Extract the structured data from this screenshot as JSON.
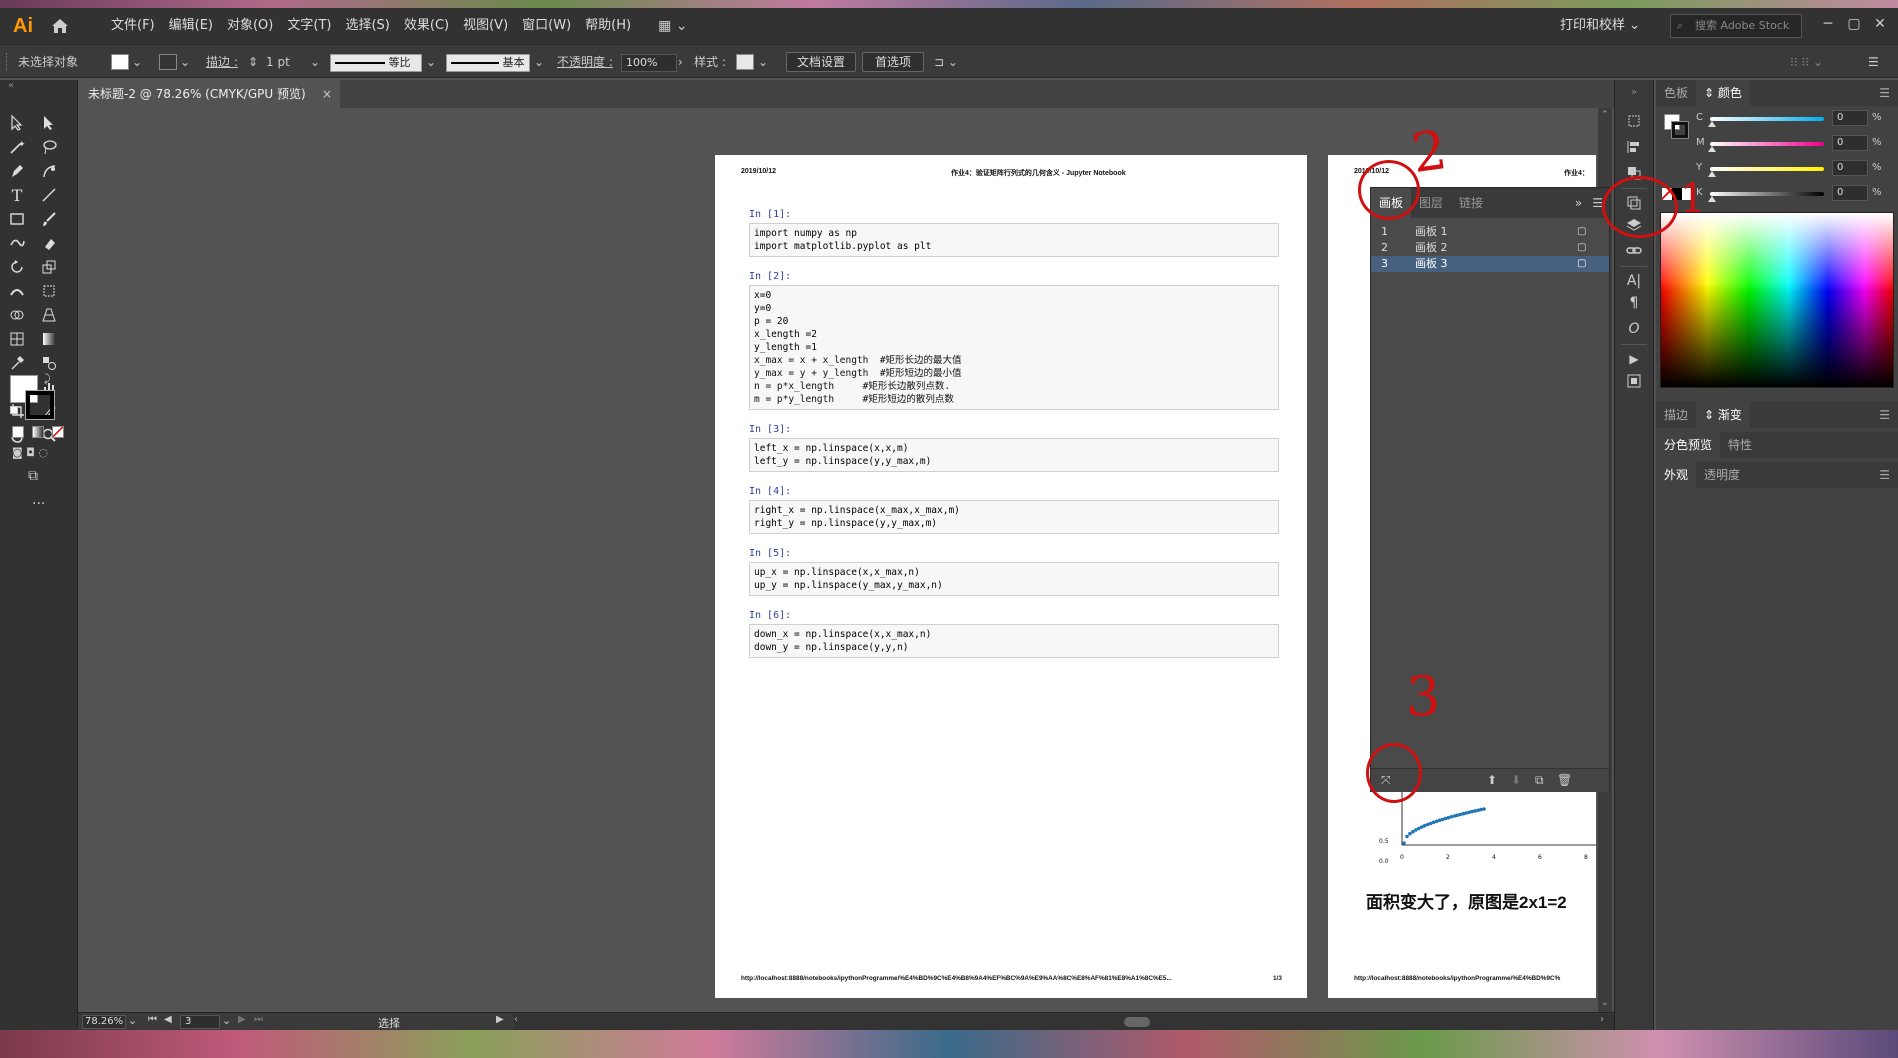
{
  "app": {
    "logo": "Ai",
    "workspace": "打印和校样",
    "search_placeholder": "搜索 Adobe Stock"
  },
  "menu": [
    "文件(F)",
    "编辑(E)",
    "对象(O)",
    "文字(T)",
    "选择(S)",
    "效果(C)",
    "视图(V)",
    "窗口(W)",
    "帮助(H)"
  ],
  "controlbar": {
    "selection": "未选择对象",
    "stroke_label": "描边 :",
    "stroke_value": "1 pt",
    "profile1": "等比",
    "profile2": "基本",
    "opacity_label": "不透明度 :",
    "opacity_value": "100%",
    "style_label": "样式 :",
    "doc_setup": "文档设置",
    "preferences": "首选项"
  },
  "document_tab": {
    "title": "未标题-2 @ 78.26% (CMYK/GPU 预览)",
    "close": "×"
  },
  "page1": {
    "date": "2019/10/12",
    "header_title": "作业4：验证矩阵行列式的几何含义 - Jupyter Notebook",
    "footer_url": "http://localhost:8888/notebooks/ipythonProgramme/%E4%BD%9C%E4%B8%9A4%EF%BC%9A%E9%AA%8C%E8%AF%81%E8%A1%8C%E5...",
    "footer_page": "1/3",
    "cells": [
      {
        "label": "In  [1]:",
        "lines": [
          "import numpy as np",
          "import matplotlib.pyplot as plt"
        ]
      },
      {
        "label": "In  [2]:",
        "lines": [
          "x=0",
          "y=0",
          "p = 20",
          "x_length =2",
          "y_length =1",
          "x_max = x + x_length  #矩形长边的最大值",
          "y_max = y + y_length  #矩形短边的最小值",
          "n = p*x_length     #矩形长边散列点数.",
          "m = p*y_length     #矩形短边的散列点数"
        ]
      },
      {
        "label": "In  [3]:",
        "lines": [
          "left_x = np.linspace(x,x,m)",
          "left_y = np.linspace(y,y_max,m)"
        ]
      },
      {
        "label": "In  [4]:",
        "lines": [
          "right_x = np.linspace(x_max,x_max,m)",
          "right_y = np.linspace(y,y_max,m)"
        ]
      },
      {
        "label": "In  [5]:",
        "lines": [
          "up_x = np.linspace(x,x_max,n)",
          "up_y = np.linspace(y_max,y_max,n)"
        ]
      },
      {
        "label": "In  [6]:",
        "lines": [
          "down_x = np.linspace(x,x_max,n)",
          "down_y = np.linspace(y,y,n)"
        ]
      }
    ]
  },
  "page2": {
    "date": "2019/10/12",
    "header_title": "作业4：",
    "big_text": "面积变大了，原图是2x1=2",
    "footer_url": "http://localhost:8888/notebooks/ipythonProgramme/%E4%BD%9C%",
    "axis_ticks_x": [
      "0",
      "2",
      "4",
      "6",
      "8"
    ],
    "axis_ticks_y": [
      "0.5",
      "0.0"
    ]
  },
  "artboard_panel": {
    "tabs": [
      "画板",
      "图层",
      "链接"
    ],
    "rows": [
      {
        "index": "1",
        "name": "画板 1"
      },
      {
        "index": "2",
        "name": "画板 2"
      },
      {
        "index": "3",
        "name": "画板 3"
      }
    ]
  },
  "right_panel": {
    "top_tabs": [
      "色板",
      "颜色"
    ],
    "channels": [
      {
        "label": "C",
        "value": "0",
        "unit": "%",
        "color": "#00aeef"
      },
      {
        "label": "M",
        "value": "0",
        "unit": "%",
        "color": "#ec008c"
      },
      {
        "label": "Y",
        "value": "0",
        "unit": "%",
        "color": "#fff200"
      },
      {
        "label": "K",
        "value": "0",
        "unit": "%",
        "color": "#000000"
      }
    ],
    "mid_tabs": [
      "描边",
      "渐变"
    ],
    "tabs3": [
      "分色预览",
      "特性"
    ],
    "tabs4": [
      "外观",
      "透明度"
    ]
  },
  "statusbar": {
    "zoom": "78.26%",
    "artboard": "3",
    "tool": "选择"
  },
  "annotations": [
    "1",
    "2",
    "3"
  ]
}
